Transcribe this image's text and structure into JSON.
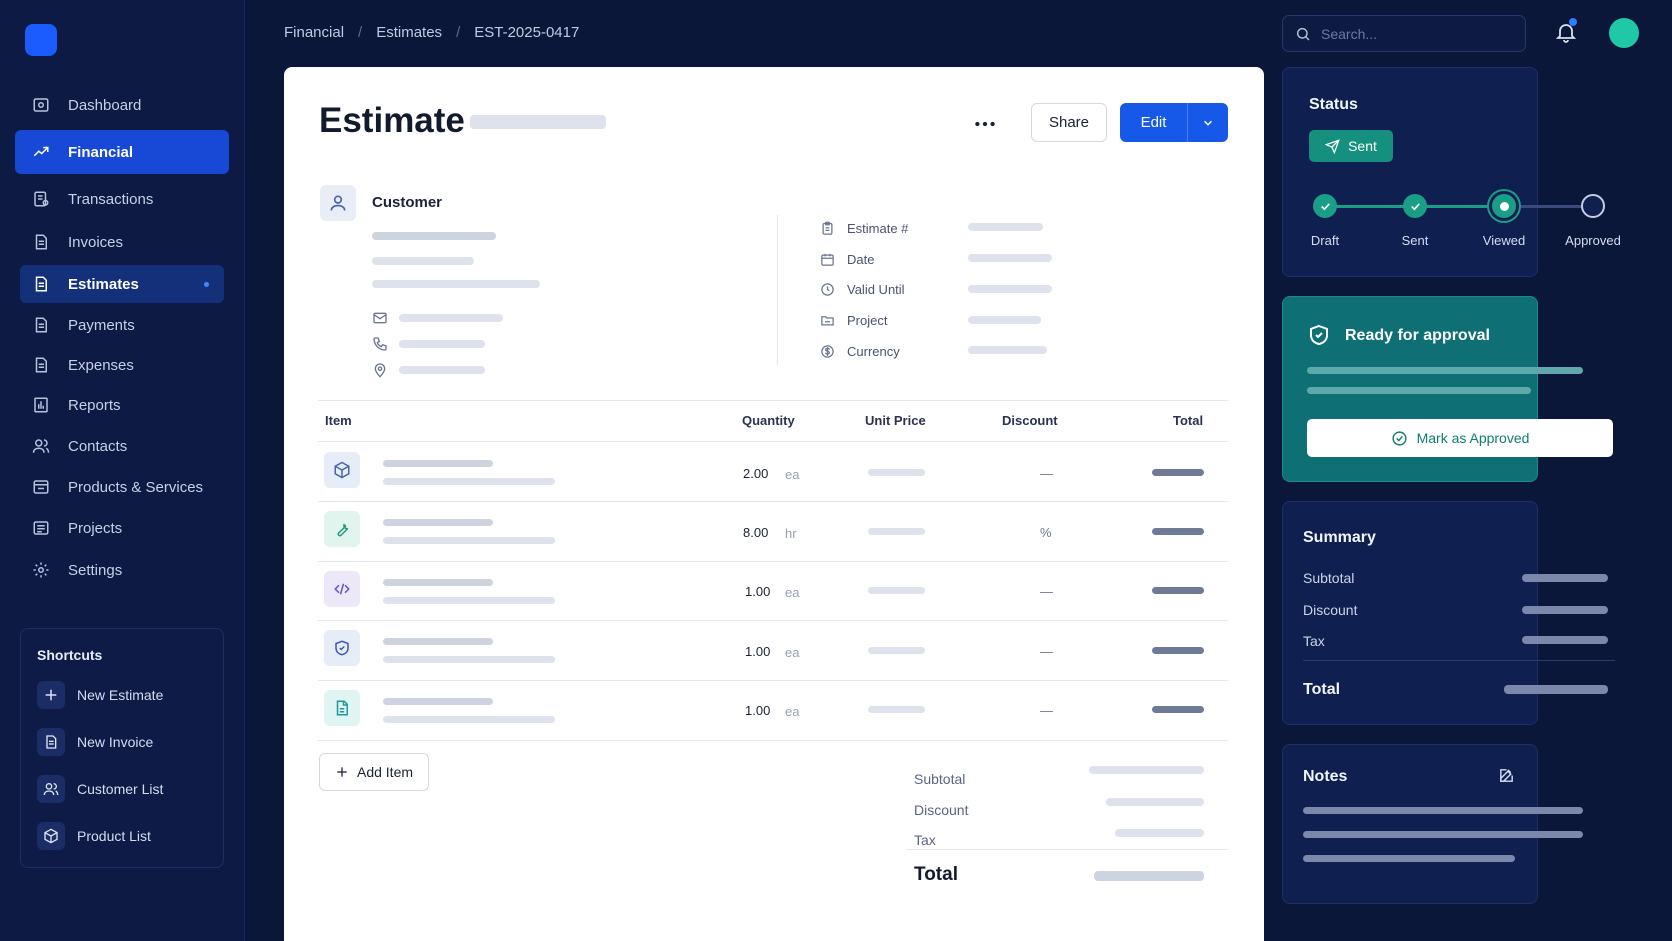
{
  "sidebar": {
    "nav": [
      {
        "label": "Dashboard",
        "icon": "dashboard-icon"
      },
      {
        "label": "Financial",
        "icon": "trend-icon"
      },
      {
        "label": "Transactions",
        "icon": "transactions-icon"
      },
      {
        "label": "Invoices",
        "icon": "document-icon"
      },
      {
        "label": "Estimates",
        "icon": "document-icon"
      },
      {
        "label": "Payments",
        "icon": "document-icon"
      },
      {
        "label": "Expenses",
        "icon": "document-icon"
      },
      {
        "label": "Reports",
        "icon": "bar-chart-icon"
      },
      {
        "label": "Contacts",
        "icon": "users-icon"
      },
      {
        "label": "Products & Services",
        "icon": "box-list-icon"
      },
      {
        "label": "Projects",
        "icon": "list-icon"
      },
      {
        "label": "Settings",
        "icon": "gear-icon"
      }
    ],
    "shortcuts": {
      "title": "Shortcuts",
      "items": [
        {
          "label": "New Estimate",
          "icon": "plus-icon"
        },
        {
          "label": "New Invoice",
          "icon": "document-icon"
        },
        {
          "label": "Customer List",
          "icon": "users-icon"
        },
        {
          "label": "Product List",
          "icon": "box-icon"
        }
      ]
    }
  },
  "topbar": {
    "breadcrumb": [
      "Financial",
      "Estimates",
      "EST-2025-0417"
    ],
    "separator": "/",
    "search_placeholder": "Search..."
  },
  "estimate": {
    "title": "Estimate",
    "share_label": "Share",
    "edit_label": "Edit",
    "customer_label": "Customer",
    "meta_labels": [
      "Estimate #",
      "Date",
      "Valid Until",
      "Project",
      "Currency"
    ],
    "columns": [
      "Item",
      "Quantity",
      "Unit Price",
      "Discount",
      "Total"
    ],
    "rows": [
      {
        "qty": "2.00",
        "unit": "ea",
        "discount": "—",
        "icon": "box-icon",
        "color": "#4a66a8",
        "bg": "#e6ecf8"
      },
      {
        "qty": "8.00",
        "unit": "hr",
        "discount": "%",
        "icon": "wrench-icon",
        "color": "#1e9a7a",
        "bg": "#e2f4ee"
      },
      {
        "qty": "1.00",
        "unit": "ea",
        "discount": "—",
        "icon": "code-icon",
        "color": "#6b4fc8",
        "bg": "#ece8fa"
      },
      {
        "qty": "1.00",
        "unit": "ea",
        "discount": "—",
        "icon": "shield-icon",
        "color": "#3a5ab0",
        "bg": "#e6ecf8"
      },
      {
        "qty": "1.00",
        "unit": "ea",
        "discount": "—",
        "icon": "file-icon",
        "color": "#1e9a9a",
        "bg": "#e0f4f3"
      }
    ],
    "add_item_label": "Add Item",
    "totals_labels": [
      "Subtotal",
      "Discount",
      "Tax"
    ],
    "grand_total_label": "Total"
  },
  "status": {
    "title": "Status",
    "badge": "Sent",
    "steps": [
      {
        "label": "Draft",
        "state": "done"
      },
      {
        "label": "Sent",
        "state": "done"
      },
      {
        "label": "Viewed",
        "state": "current"
      },
      {
        "label": "Approved",
        "state": "pending"
      }
    ],
    "colors": {
      "accent": "#1a9e86",
      "pending": "#3a4a7c"
    }
  },
  "approval": {
    "title": "Ready for approval",
    "button_label": "Mark as Approved"
  },
  "summary": {
    "title": "Summary",
    "labels": [
      "Subtotal",
      "Discount",
      "Tax"
    ],
    "total_label": "Total"
  },
  "notes": {
    "title": "Notes"
  }
}
